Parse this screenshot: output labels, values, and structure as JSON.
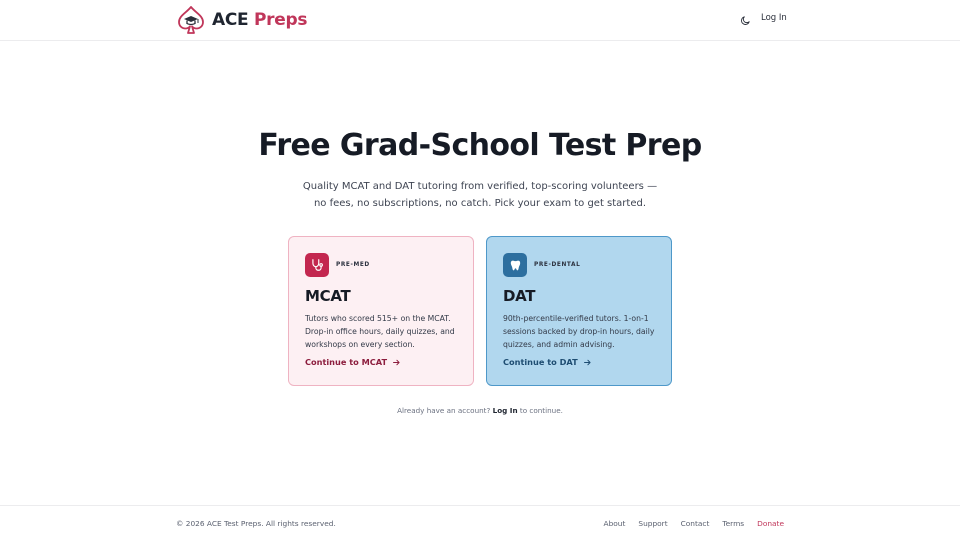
{
  "header": {
    "brand_ace": "ACE",
    "brand_preps": "Preps",
    "login_label": "Log In"
  },
  "hero": {
    "title": "Free Grad-School Test Prep",
    "subtitle_line1": "Quality MCAT and DAT tutoring from verified, top-scoring volunteers —",
    "subtitle_line2": "no fees, no subscriptions, no catch. Pick your exam to get started."
  },
  "cards": [
    {
      "tag": "PRE-MED",
      "title": "MCAT",
      "description": "Tutors who scored 515+ on the MCAT. Drop-in office hours, daily quizzes, and workshops on every section.",
      "cta": "Continue to MCAT",
      "icon": "stethoscope-icon"
    },
    {
      "tag": "PRE-DENTAL",
      "title": "DAT",
      "description": "90th-percentile-verified tutors. 1-on-1 sessions backed by drop-in hours, daily quizzes, and admin advising.",
      "cta": "Continue to DAT",
      "icon": "tooth-icon"
    }
  ],
  "account": {
    "prefix": "Already have an account?",
    "login": "Log In",
    "suffix": "to continue."
  },
  "footer": {
    "copyright": "© 2026 ACE Test Preps. All rights reserved.",
    "links": [
      "About",
      "Support",
      "Contact",
      "Terms",
      "Donate"
    ]
  },
  "colors": {
    "brand": "#c0365a",
    "mcat_card_bg": "#fdf0f3",
    "dat_card_bg": "#b1d7ee",
    "mcat_icon_bg": "#c3274f",
    "dat_icon_bg": "#2d6f9f"
  }
}
